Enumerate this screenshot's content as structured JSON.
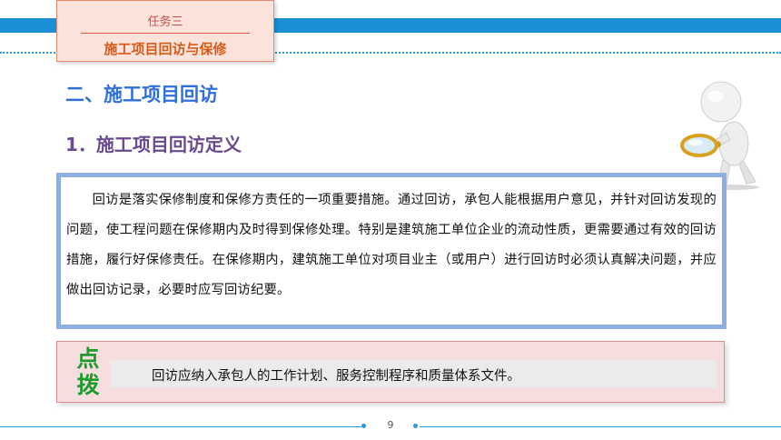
{
  "header": {
    "task_number": "任务三",
    "task_title": "施工项目回访与保修"
  },
  "section_heading": "二、施工项目回访",
  "sub_heading": "1．施工项目回访定义",
  "definition_text": "回访是落实保修制度和保修方责任的一项重要措施。通过回访，承包人能根据用户意见，并针对回访发现的问题，使工程问题在保修期内及时得到保修处理。特别是建筑施工单位企业的流动性质，更需要通过有效的回访措施，履行好保修责任。在保修期内，建筑施工单位对项目业主（或用户）进行回访时必须认真解决问题，并应做出回访记录，必要时应写回访纪要。",
  "tip": {
    "label": "点拨",
    "text": "回访应纳入承包人的工作计划、服务控制程序和质量体系文件。"
  },
  "footer": {
    "page_number": "9"
  },
  "colors": {
    "top_band": "#1b8fd6",
    "section_heading": "#2f6fdc",
    "sub_heading": "#6a4a8e",
    "task_title": "#d85a18",
    "tip_label": "#1e9a2e",
    "definition_border": "#8eb0e0"
  },
  "icons": {
    "figure": "magnifier-figure-icon"
  }
}
